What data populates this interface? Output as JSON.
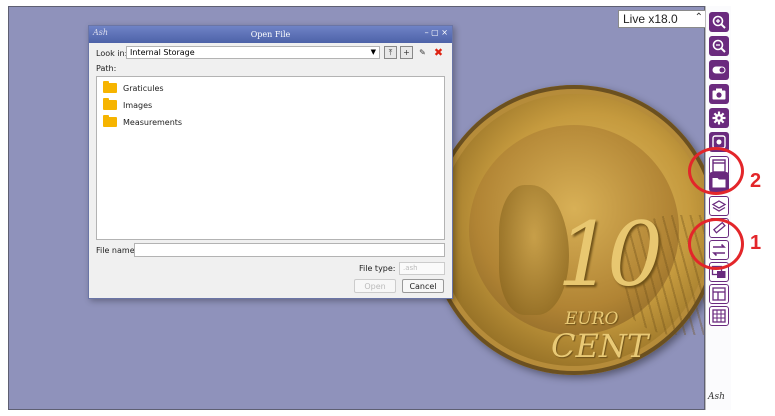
{
  "zoom": {
    "value": "Live x18.0"
  },
  "coin": {
    "numeral": "10",
    "euro": "EURO",
    "cent": "CENT"
  },
  "dialog": {
    "title": "Open File",
    "look_in_label": "Look in:",
    "look_in_value": "Internal Storage",
    "path_label": "Path:",
    "folders": [
      "Graticules",
      "Images",
      "Measurements"
    ],
    "file_name_label": "File name:",
    "file_name_value": "",
    "file_type_label": "File type:",
    "file_type_value": ".ash",
    "open_label": "Open",
    "cancel_label": "Cancel"
  },
  "toolbar_icons": [
    "zoom-in-icon",
    "zoom-out-icon",
    "toggle-icon",
    "camera-icon",
    "settings-icon",
    "fit-icon",
    "window-icon",
    "folder-open-icon",
    "layers-icon",
    "measure-icon",
    "swap-icon",
    "export-icon",
    "layout-icon",
    "grid-icon"
  ],
  "callouts": {
    "first": "1",
    "second": "2"
  },
  "brand": {
    "logo": "Ash"
  },
  "colors": {
    "accent": "#6a2a7e",
    "callout": "#e3262a",
    "background": "#8f92bb"
  }
}
